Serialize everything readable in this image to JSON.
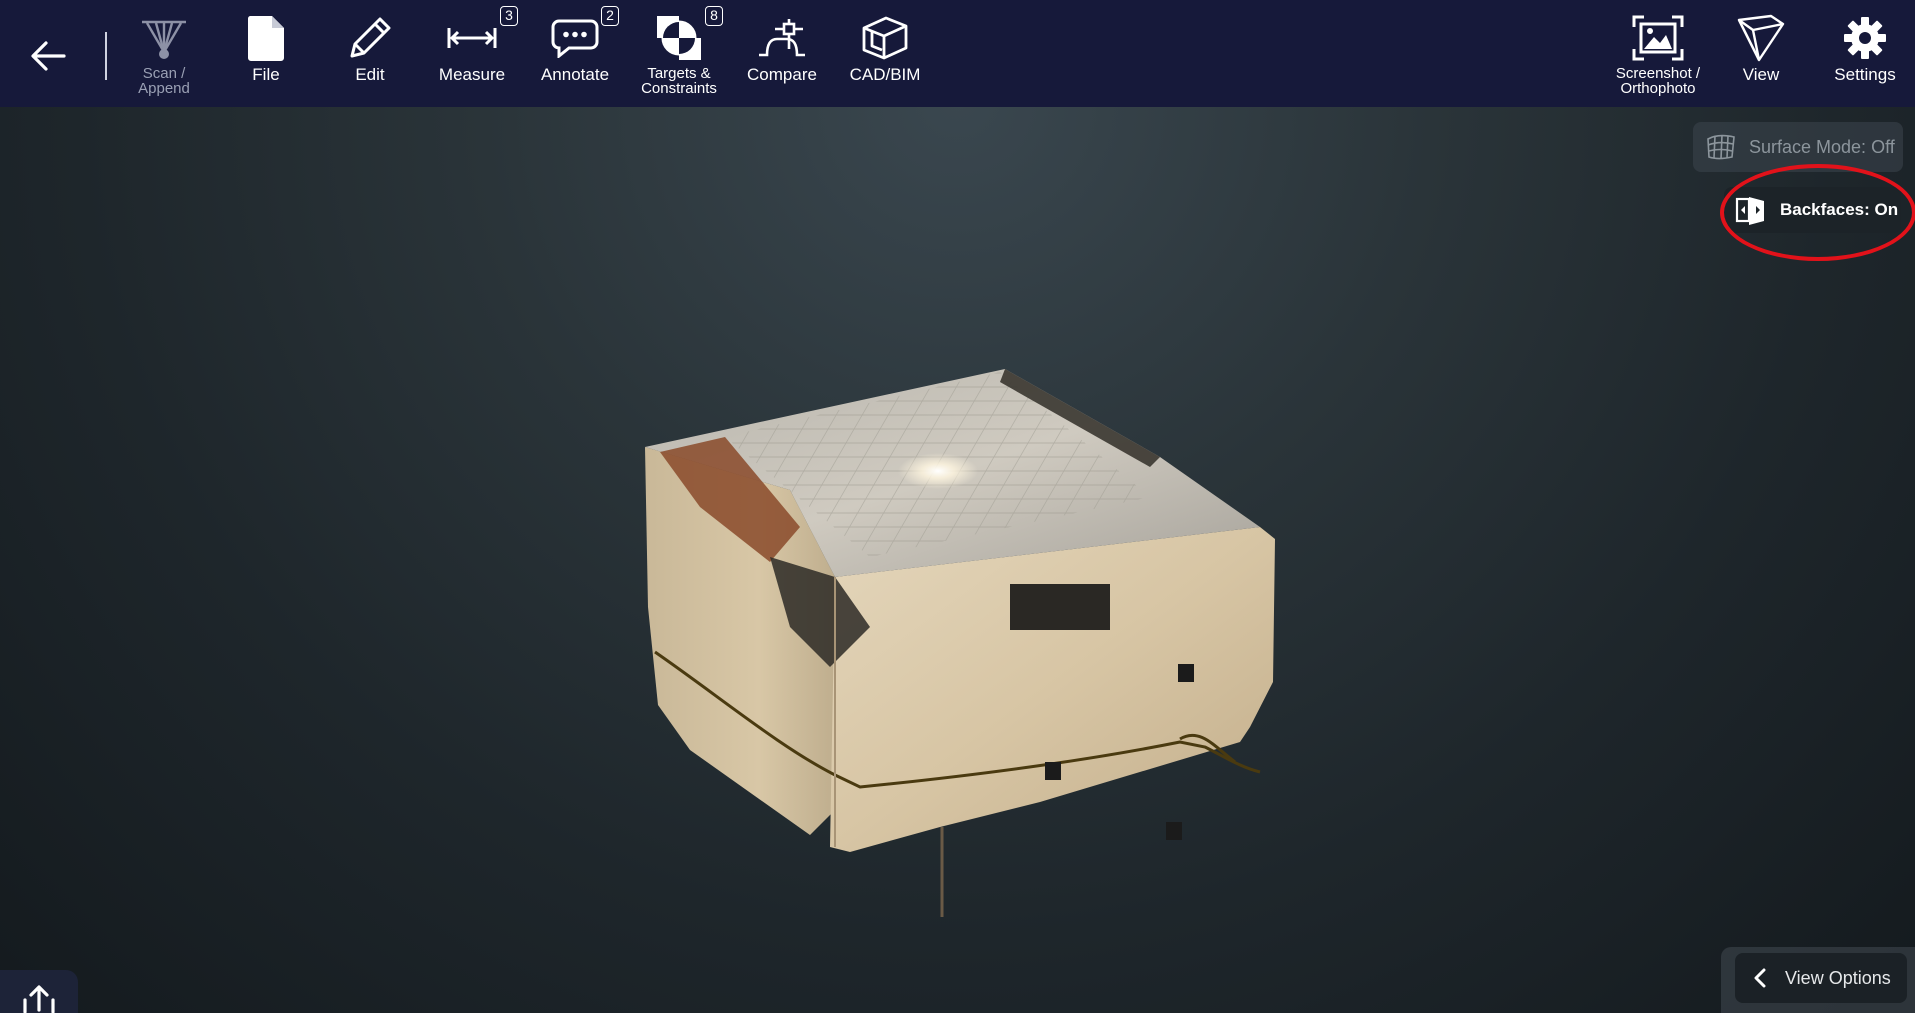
{
  "toolbar": {
    "items": [
      {
        "label": "Scan /\nAppend",
        "icon": "scan-append-icon",
        "disabled": true
      },
      {
        "label": "File",
        "icon": "file-icon"
      },
      {
        "label": "Edit",
        "icon": "pencil-icon"
      },
      {
        "label": "Measure",
        "icon": "measure-icon",
        "badge": "3"
      },
      {
        "label": "Annotate",
        "icon": "annotate-icon",
        "badge": "2"
      },
      {
        "label": "Targets &\nConstraints",
        "icon": "target-icon",
        "badge": "8"
      },
      {
        "label": "Compare",
        "icon": "compare-icon"
      },
      {
        "label": "CAD/BIM",
        "icon": "cad-bim-icon"
      },
      {
        "label": "Screenshot /\nOrthophoto",
        "icon": "screenshot-icon"
      },
      {
        "label": "View",
        "icon": "view-cube-icon"
      },
      {
        "label": "Settings",
        "icon": "gear-icon"
      }
    ]
  },
  "overlay": {
    "surface_mode": "Surface Mode: Off",
    "backfaces": "Backfaces: On",
    "view_options": "View Options"
  },
  "colors": {
    "toolbar_bg": "#16193a",
    "highlight": "#e2121a"
  }
}
